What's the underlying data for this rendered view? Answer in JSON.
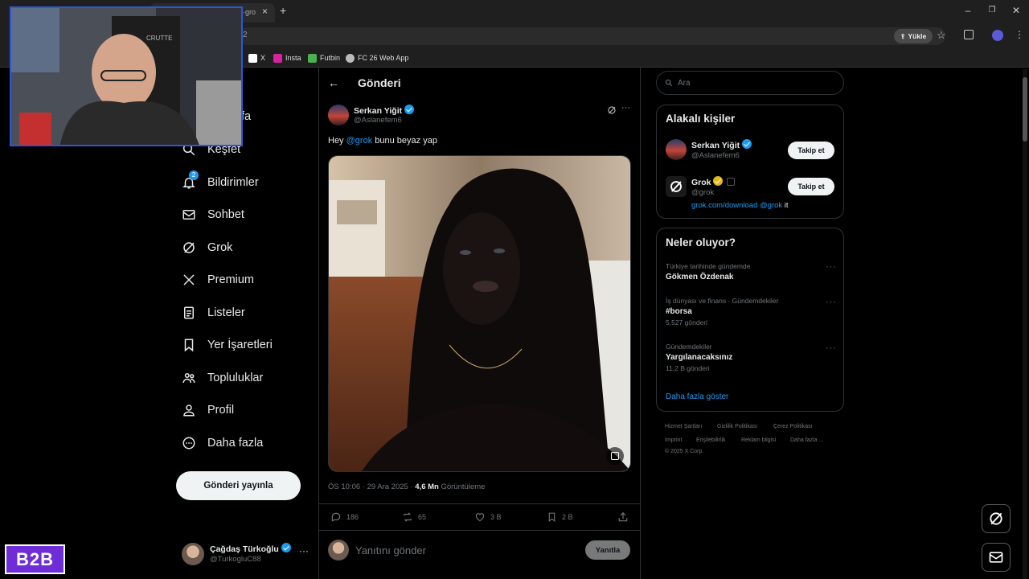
{
  "browser": {
    "tab_title_partial": "·gro",
    "omnibox_text": "2",
    "update_button": "Yükle",
    "bookmarks": [
      {
        "label": "X",
        "icon": "x-icon"
      },
      {
        "label": "Insta",
        "icon": "instagram-icon"
      },
      {
        "label": "Futbin",
        "icon": "futbin-icon"
      },
      {
        "label": "FC 26 Web App",
        "icon": "globe-icon"
      }
    ]
  },
  "webcam": {
    "chair_brand": "CRUTTE"
  },
  "sidebar": {
    "items": [
      {
        "label": "fa",
        "icon": "home-icon"
      },
      {
        "label": "Keşfet",
        "icon": "search-icon"
      },
      {
        "label": "Bildirimler",
        "icon": "bell-icon",
        "badge": "2"
      },
      {
        "label": "Sohbet",
        "icon": "mail-icon"
      },
      {
        "label": "Grok",
        "icon": "grok-icon"
      },
      {
        "label": "Premium",
        "icon": "x-logo-icon"
      },
      {
        "label": "Listeler",
        "icon": "list-icon"
      },
      {
        "label": "Yer İşaretleri",
        "icon": "bookmark-icon"
      },
      {
        "label": "Topluluklar",
        "icon": "communities-icon"
      },
      {
        "label": "Profil",
        "icon": "profile-icon"
      },
      {
        "label": "Daha fazla",
        "icon": "more-circle-icon"
      }
    ],
    "post_button": "Gönderi yayınla",
    "account": {
      "name": "Çağdaş Türkoğlu",
      "handle": "@TurkogluC88"
    }
  },
  "main": {
    "title": "Gönderi",
    "post": {
      "author_name": "Serkan Yiğit",
      "author_handle": "@Aslanefem6",
      "text_prefix": "Hey ",
      "mention": "@grok",
      "text_suffix": " bunu beyaz yap",
      "timestamp": "ÖS 10:06 · 29 Ara 2025 · ",
      "views_count": "4,6 Mn",
      "views_label": " Görüntüleme",
      "replies": "186",
      "reposts": "65",
      "likes": "3 B",
      "bookmarks": "2 B"
    },
    "reply_box": {
      "placeholder": "Yanıtını gönder",
      "button": "Yanıtla"
    }
  },
  "right": {
    "search_placeholder": "Ara",
    "related_title": "Alakalı kişiler",
    "people": [
      {
        "name": "Serkan Yiğit",
        "handle": "@Aslanefem6",
        "follow": "Takip et"
      },
      {
        "name": "Grok",
        "handle": "@grok",
        "follow": "Takip et",
        "bio_link": "grok.com/download",
        "bio_mention": "@grok",
        "bio_suffix": " it"
      }
    ],
    "trends_title": "Neler oluyor?",
    "trends": [
      {
        "category": "Türkiye tarihinde gündemde",
        "name": "Gökmen Özdenak",
        "count": ""
      },
      {
        "category": "İş dünyası ve finans · Gündemdekiler",
        "name": "#borsa",
        "count": "5.527 gönderi"
      },
      {
        "category": "Gündemdekiler",
        "name": "Yargılanacaksınız",
        "count": "11,2 B gönderi"
      }
    ],
    "show_more": "Daha fazla göster",
    "footer": [
      "Hizmet Şartları",
      "Gizlilik Politikası",
      "Çerez Politikası",
      "Imprint",
      "Erişilebilirlik",
      "Reklam bilgisi",
      "Daha fazla ...",
      "© 2025 X Corp."
    ]
  },
  "overlay": {
    "logo_text": "B2B"
  },
  "colors": {
    "accent": "#1d9bf0",
    "background": "#000000",
    "border": "#2f3336",
    "muted": "#71767b",
    "logo_purple": "#6f2dd8"
  }
}
